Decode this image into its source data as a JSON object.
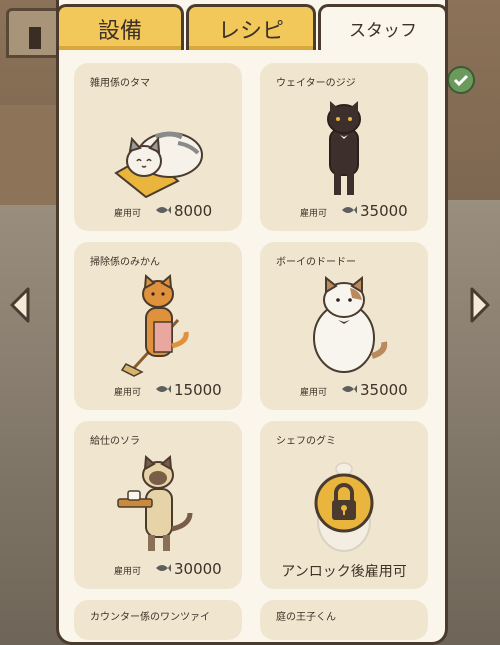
{
  "tabs": [
    {
      "label": "設備",
      "active": false
    },
    {
      "label": "レシピ",
      "active": false
    },
    {
      "label": "スタッフ",
      "active": true
    }
  ],
  "colors": {
    "tab_yellow": "#f2c85a",
    "card_bg": "#f0e6cf",
    "panel_bg": "#fbf6ec",
    "lock_gold": "#e9b53c"
  },
  "staff": [
    {
      "name": "雑用係のタマ",
      "hire_label": "雇用可",
      "price": "8000",
      "icon": "cat-on-mat"
    },
    {
      "name": "ウェイターのジジ",
      "hire_label": "雇用可",
      "price": "35000",
      "icon": "black-cat-tuxedo"
    },
    {
      "name": "掃除係のみかん",
      "hire_label": "雇用可",
      "price": "15000",
      "icon": "orange-cat-broom"
    },
    {
      "name": "ボーイのドードー",
      "hire_label": "雇用可",
      "price": "35000",
      "icon": "fluffy-white-cat"
    },
    {
      "name": "給仕のソラ",
      "hire_label": "雇用可",
      "price": "30000",
      "icon": "siamese-cat-tray"
    },
    {
      "name": "シェフのグミ",
      "locked_text": "アンロック後雇用可",
      "icon": "lock-icon"
    },
    {
      "name": "カウンター係のワンツァイ",
      "icon": ""
    },
    {
      "name": "庭の王子くん",
      "icon": ""
    }
  ]
}
